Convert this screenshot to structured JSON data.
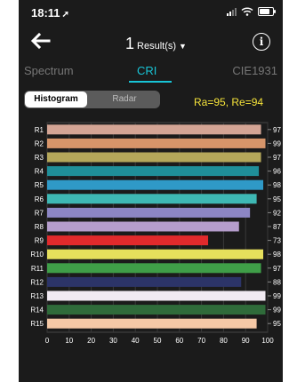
{
  "status_bar": {
    "time": "18:11",
    "location_arrow": "➚",
    "signal_icon": "signal-icon",
    "wifi_icon": "wifi-icon",
    "battery_icon": "battery-icon"
  },
  "nav": {
    "back_icon": "arrow-left-icon",
    "result_count": "1",
    "result_label": "Result(s)",
    "caret": "▼",
    "info_icon": "info-icon",
    "info_glyph": "i"
  },
  "tabs": [
    "Spectrum",
    "CRI",
    "CIE1931"
  ],
  "active_tab": "CRI",
  "view_toggle": {
    "options": [
      "Histogram",
      "Radar"
    ],
    "active": "Histogram"
  },
  "summary": "Ra=95, Re=94",
  "colors": {
    "accent": "#18c4d6",
    "summary": "#f5e33a",
    "background": "#1b1b1b"
  },
  "chart_data": {
    "type": "bar",
    "orientation": "horizontal",
    "categories": [
      "R1",
      "R2",
      "R3",
      "R4",
      "R5",
      "R6",
      "R7",
      "R8",
      "R9",
      "R10",
      "R11",
      "R12",
      "R13",
      "R14",
      "R15"
    ],
    "values": [
      97,
      99,
      97,
      96,
      98,
      95,
      92,
      87,
      73,
      98,
      97,
      88,
      99,
      99,
      95
    ],
    "value_labels": [
      "97",
      "99",
      "97",
      "96",
      "98",
      "95",
      "92",
      "87",
      "73",
      "98",
      "97",
      "88",
      "99",
      "99",
      "95"
    ],
    "bar_colors": [
      "#d4a595",
      "#d7956a",
      "#b4a75a",
      "#1f8f99",
      "#2f99c7",
      "#3eb8b4",
      "#8c86c4",
      "#b59dcc",
      "#e12a2c",
      "#e6e05c",
      "#3f9e48",
      "#2c3468",
      "#f1eaf2",
      "#2f6b3a",
      "#f5c8a6"
    ],
    "xlim": [
      0,
      100
    ],
    "xticks": [
      "0",
      "10",
      "20",
      "30",
      "40",
      "50",
      "60",
      "70",
      "80",
      "90",
      "100"
    ],
    "grid": true
  }
}
